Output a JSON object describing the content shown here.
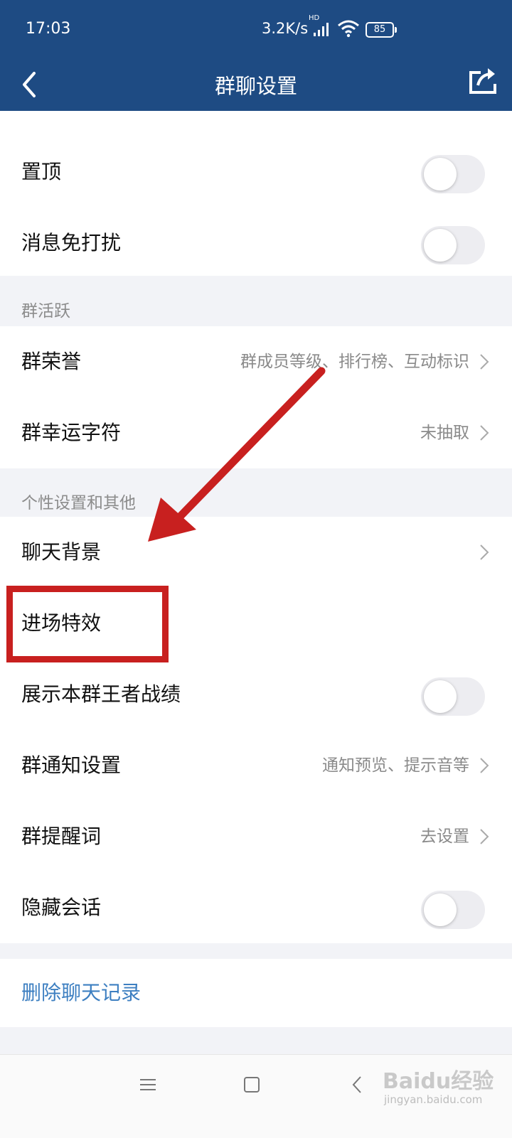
{
  "status_bar": {
    "time": "17:03",
    "net_speed": "3.2K/s",
    "hd": "HD",
    "battery": "85"
  },
  "header": {
    "title": "群聊设置"
  },
  "rows_top": [
    {
      "label": "置顶",
      "toggle": false
    },
    {
      "label": "消息免打扰",
      "toggle": false
    }
  ],
  "section_active": "群活跃",
  "rows_active": [
    {
      "label": "群荣誉",
      "value": "群成员等级、排行榜、互动标识"
    },
    {
      "label": "群幸运字符",
      "value": "未抽取"
    }
  ],
  "section_personal": "个性设置和其他",
  "rows_personal": [
    {
      "label": "聊天背景"
    },
    {
      "label": "进场特效"
    },
    {
      "label": "展示本群王者战绩",
      "toggle": false
    },
    {
      "label": "群通知设置",
      "value": "通知预览、提示音等"
    },
    {
      "label": "群提醒词",
      "value": "去设置"
    },
    {
      "label": "隐藏会话",
      "toggle": false
    }
  ],
  "delete_action": {
    "label": "删除聊天记录",
    "color": "#3d7fc1"
  },
  "watermark": {
    "brand": "Baidu经验",
    "url": "jingyan.baidu.com"
  },
  "accent_colors": {
    "header": "#1e4b83",
    "annotation": "#c8201f"
  }
}
